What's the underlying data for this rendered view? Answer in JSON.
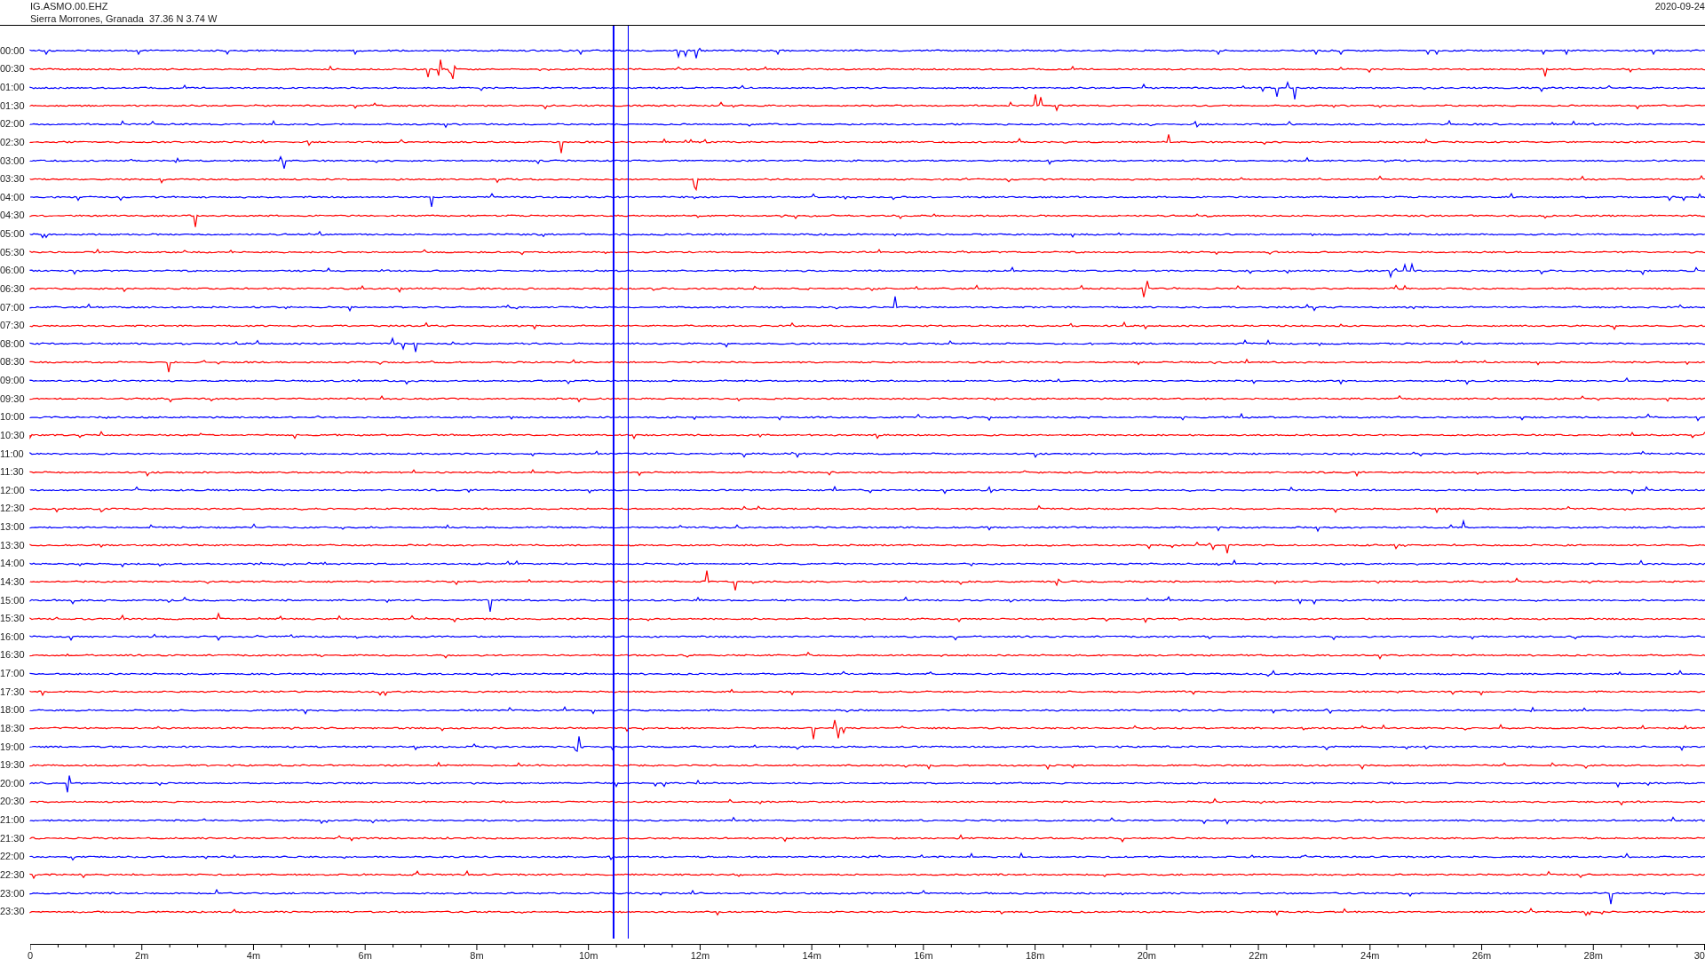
{
  "header": {
    "station": "IG.ASMO.00.EHZ",
    "location": "Sierra Morrones, Granada  37.36 N 3.74 W",
    "date": "2020-09-24"
  },
  "rows": [
    {
      "label": "00:00",
      "color": "#0000ff"
    },
    {
      "label": "00:30",
      "color": "#ff0000"
    },
    {
      "label": "01:00",
      "color": "#0000ff"
    },
    {
      "label": "01:30",
      "color": "#ff0000"
    },
    {
      "label": "02:00",
      "color": "#0000ff"
    },
    {
      "label": "02:30",
      "color": "#ff0000"
    },
    {
      "label": "03:00",
      "color": "#0000ff"
    },
    {
      "label": "03:30",
      "color": "#ff0000"
    },
    {
      "label": "04:00",
      "color": "#0000ff"
    },
    {
      "label": "04:30",
      "color": "#ff0000"
    },
    {
      "label": "05:00",
      "color": "#0000ff"
    },
    {
      "label": "05:30",
      "color": "#ff0000"
    },
    {
      "label": "06:00",
      "color": "#0000ff"
    },
    {
      "label": "06:30",
      "color": "#ff0000"
    },
    {
      "label": "07:00",
      "color": "#0000ff"
    },
    {
      "label": "07:30",
      "color": "#ff0000"
    },
    {
      "label": "08:00",
      "color": "#0000ff"
    },
    {
      "label": "08:30",
      "color": "#ff0000"
    },
    {
      "label": "09:00",
      "color": "#0000ff"
    },
    {
      "label": "09:30",
      "color": "#ff0000"
    },
    {
      "label": "10:00",
      "color": "#0000ff"
    },
    {
      "label": "10:30",
      "color": "#ff0000"
    },
    {
      "label": "11:00",
      "color": "#0000ff"
    },
    {
      "label": "11:30",
      "color": "#ff0000"
    },
    {
      "label": "12:00",
      "color": "#0000ff"
    },
    {
      "label": "12:30",
      "color": "#ff0000"
    },
    {
      "label": "13:00",
      "color": "#0000ff"
    },
    {
      "label": "13:30",
      "color": "#ff0000"
    },
    {
      "label": "14:00",
      "color": "#0000ff"
    },
    {
      "label": "14:30",
      "color": "#ff0000"
    },
    {
      "label": "15:00",
      "color": "#0000ff"
    },
    {
      "label": "15:30",
      "color": "#ff0000"
    },
    {
      "label": "16:00",
      "color": "#0000ff"
    },
    {
      "label": "16:30",
      "color": "#ff0000"
    },
    {
      "label": "17:00",
      "color": "#0000ff"
    },
    {
      "label": "17:30",
      "color": "#ff0000"
    },
    {
      "label": "18:00",
      "color": "#0000ff"
    },
    {
      "label": "18:30",
      "color": "#ff0000"
    },
    {
      "label": "19:00",
      "color": "#0000ff"
    },
    {
      "label": "19:30",
      "color": "#ff0000"
    },
    {
      "label": "20:00",
      "color": "#0000ff"
    },
    {
      "label": "20:30",
      "color": "#ff0000"
    },
    {
      "label": "21:00",
      "color": "#0000ff"
    },
    {
      "label": "21:30",
      "color": "#ff0000"
    },
    {
      "label": "22:00",
      "color": "#0000ff"
    },
    {
      "label": "22:30",
      "color": "#ff0000"
    },
    {
      "label": "23:00",
      "color": "#0000ff"
    },
    {
      "label": "23:30",
      "color": "#ff0000"
    }
  ],
  "x_axis": {
    "ticks": [
      "0",
      "2m",
      "4m",
      "6m",
      "8m",
      "10m",
      "12m",
      "14m",
      "16m",
      "18m",
      "20m",
      "22m",
      "24m",
      "26m",
      "28m",
      "30"
    ]
  }
}
